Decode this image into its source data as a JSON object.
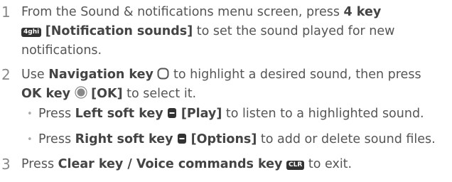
{
  "steps": [
    {
      "num": "1",
      "line1": {
        "pre": "From the Sound & notifications menu screen, press ",
        "key": "4 key",
        "keycap": "4ghi"
      },
      "line2": {
        "bracket": "[Notification sounds]",
        "post": " to set the sound played for new"
      },
      "line3": "notifications."
    },
    {
      "num": "2",
      "line1": {
        "pre": "Use ",
        "key": "Navigation key",
        "post": " to highlight a desired sound, then press"
      },
      "line2": {
        "key": "OK key",
        "bracket": "[OK]",
        "post": " to select it."
      },
      "bullets": [
        {
          "pre": "Press ",
          "key": "Left soft key",
          "bracket": "[Play]",
          "post": " to listen to a highlighted sound."
        },
        {
          "pre": "Press ",
          "key": "Right soft key",
          "bracket": "[Options]",
          "post": " to add or delete sound files."
        }
      ]
    },
    {
      "num": "3",
      "line1": {
        "pre": "Press ",
        "key": "Clear key / Voice commands key",
        "keycap": "CLR",
        "post": " to exit."
      }
    }
  ]
}
